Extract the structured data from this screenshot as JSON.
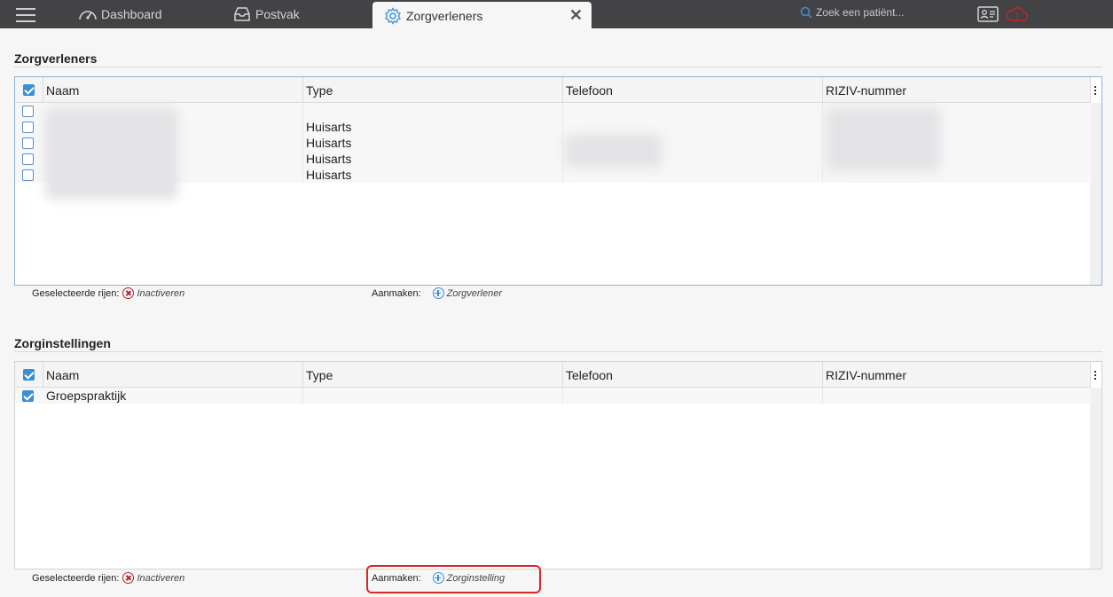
{
  "topbar": {
    "tabs": [
      {
        "label": "Dashboard",
        "icon": "gauge-icon"
      },
      {
        "label": "Postvak",
        "icon": "inbox-icon"
      },
      {
        "label": "Zorgverleners",
        "icon": "gear-icon",
        "active": true
      }
    ],
    "close_label": "✕",
    "search_placeholder": "Zoek een patiënt..."
  },
  "zorgverleners": {
    "title": "Zorgverleners",
    "columns": {
      "naam": "Naam",
      "type": "Type",
      "telefoon": "Telefoon",
      "riziv": "RIZIV-nummer"
    },
    "rows": [
      {
        "checked": false,
        "naam": "",
        "type": "",
        "telefoon": "",
        "riziv": ""
      },
      {
        "checked": false,
        "naam": "",
        "type": "Huisarts",
        "telefoon": "",
        "riziv": ""
      },
      {
        "checked": false,
        "naam": "",
        "type": "Huisarts",
        "telefoon": "",
        "riziv": ""
      },
      {
        "checked": false,
        "naam": "",
        "type": "Huisarts",
        "telefoon": "",
        "riziv": ""
      },
      {
        "checked": false,
        "naam": "",
        "type": "Huisarts",
        "telefoon": "",
        "riziv": ""
      }
    ],
    "footer": {
      "selected_label": "Geselecteerde rijen:",
      "deactivate_label": "Inactiveren",
      "create_label": "Aanmaken:",
      "create_action": "Zorgverlener"
    }
  },
  "zorginstellingen": {
    "title": "Zorginstellingen",
    "columns": {
      "naam": "Naam",
      "type": "Type",
      "telefoon": "Telefoon",
      "riziv": "RIZIV-nummer"
    },
    "rows": [
      {
        "checked": true,
        "naam": "Groepspraktijk",
        "type": "",
        "telefoon": "",
        "riziv": ""
      }
    ],
    "footer": {
      "selected_label": "Geselecteerde rijen:",
      "deactivate_label": "Inactiveren",
      "create_label": "Aanmaken:",
      "create_action": "Zorginstelling"
    }
  },
  "colors": {
    "topbar": "#434345",
    "accent": "#3a8fd4",
    "danger": "#b0242a",
    "highlight": "#d42a2a"
  }
}
